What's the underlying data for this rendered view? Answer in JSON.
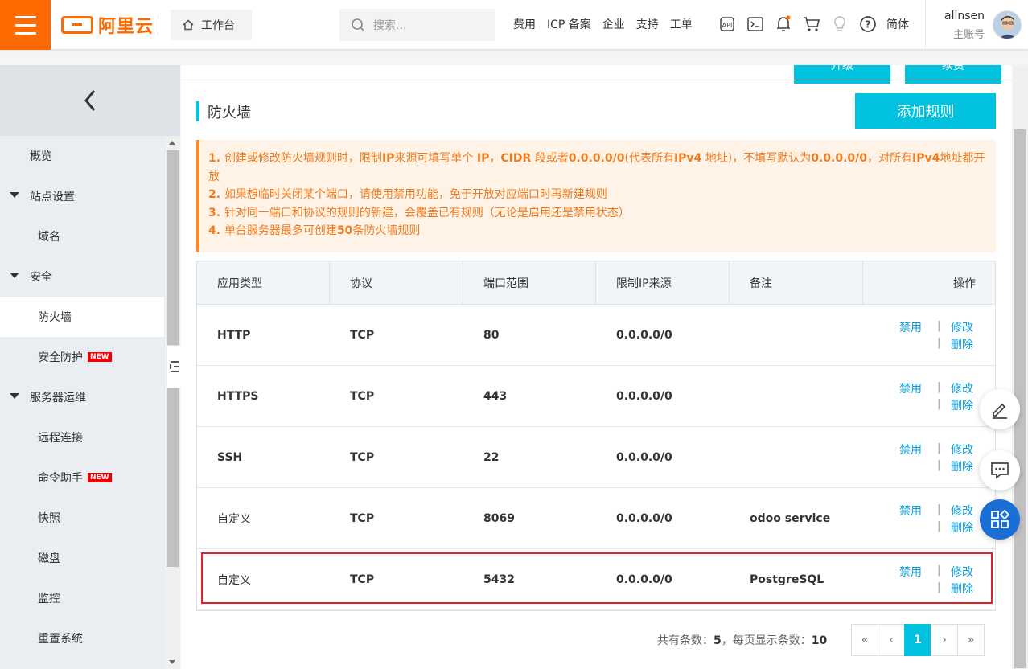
{
  "header": {
    "logo_text": "阿里云",
    "workbench": "工作台",
    "search_placeholder": "搜索...",
    "nav": [
      "费用",
      "ICP 备案",
      "企业",
      "支持",
      "工单"
    ],
    "lang": "简体",
    "user_name": "allnsen",
    "user_role": "主账号"
  },
  "sidebar": {
    "items": [
      {
        "label": "概览",
        "level": 1,
        "caret": false,
        "badge": "",
        "active": false
      },
      {
        "label": "站点设置",
        "level": 1,
        "caret": true,
        "badge": "",
        "active": false
      },
      {
        "label": "域名",
        "level": 2,
        "caret": false,
        "badge": "",
        "active": false
      },
      {
        "label": "安全",
        "level": 1,
        "caret": true,
        "badge": "",
        "active": false
      },
      {
        "label": "防火墙",
        "level": 2,
        "caret": false,
        "badge": "",
        "active": true
      },
      {
        "label": "安全防护",
        "level": 2,
        "caret": false,
        "badge": "NEW",
        "active": false
      },
      {
        "label": "服务器运维",
        "level": 1,
        "caret": true,
        "badge": "",
        "active": false
      },
      {
        "label": "远程连接",
        "level": 2,
        "caret": false,
        "badge": "",
        "active": false
      },
      {
        "label": "命令助手",
        "level": 2,
        "caret": false,
        "badge": "NEW",
        "active": false
      },
      {
        "label": "快照",
        "level": 2,
        "caret": false,
        "badge": "",
        "active": false
      },
      {
        "label": "磁盘",
        "level": 2,
        "caret": false,
        "badge": "",
        "active": false
      },
      {
        "label": "监控",
        "level": 2,
        "caret": false,
        "badge": "",
        "active": false
      },
      {
        "label": "重置系统",
        "level": 2,
        "caret": false,
        "badge": "",
        "active": false
      }
    ]
  },
  "main": {
    "top_buttons": [
      "升级",
      "续费"
    ],
    "title": "防火墙",
    "add_button": "添加规则",
    "notice": [
      {
        "num": "1.",
        "text_html": "创建或修改防火墙规则时，限制<b>IP</b>来源可填写单个 <b>IP</b>，<b>CIDR</b> 段或者<b>0.0.0.0/0</b>(代表所有<b>IPv4</b> 地址)，不填写默认为<b>0.0.0.0/0</b>，对所有<b>IPv4</b>地址都开放"
      },
      {
        "num": "2.",
        "text_html": "如果想临时关闭某个端口，请使用禁用功能，免于开放对应端口时再新建规则"
      },
      {
        "num": "3.",
        "text_html": "针对同一端口和协议的规则的新建，会覆盖已有规则（无论是启用还是禁用状态）"
      },
      {
        "num": "4.",
        "text_html": "单台服务器最多可创建<b>50</b>条防火墙规则"
      }
    ],
    "table": {
      "headers": [
        "应用类型",
        "协议",
        "端口范围",
        "限制IP来源",
        "备注",
        "操作"
      ],
      "rows": [
        {
          "type": "HTTP",
          "protocol": "TCP",
          "port": "80",
          "ip": "0.0.0.0/0",
          "note": ""
        },
        {
          "type": "HTTPS",
          "protocol": "TCP",
          "port": "443",
          "ip": "0.0.0.0/0",
          "note": ""
        },
        {
          "type": "SSH",
          "protocol": "TCP",
          "port": "22",
          "ip": "0.0.0.0/0",
          "note": ""
        },
        {
          "type": "自定义",
          "protocol": "TCP",
          "port": "8069",
          "ip": "0.0.0.0/0",
          "note": "odoo service"
        },
        {
          "type": "自定义",
          "protocol": "TCP",
          "port": "5432",
          "ip": "0.0.0.0/0",
          "note": "PostgreSQL"
        }
      ],
      "actions": {
        "disable": "禁用",
        "edit": "修改",
        "delete": "删除",
        "sep": "|"
      }
    },
    "pager": {
      "total_label": "共有条数：",
      "total": "5",
      "per_page_label": "，每页显示条数：",
      "per_page": "10",
      "buttons": [
        "«",
        "‹",
        "1",
        "›",
        "»"
      ],
      "current": "1"
    }
  },
  "colors": {
    "brand": "#ff6a00",
    "accent": "#00c1de",
    "link": "#0aa1e0",
    "highlight": "#e0202a"
  }
}
